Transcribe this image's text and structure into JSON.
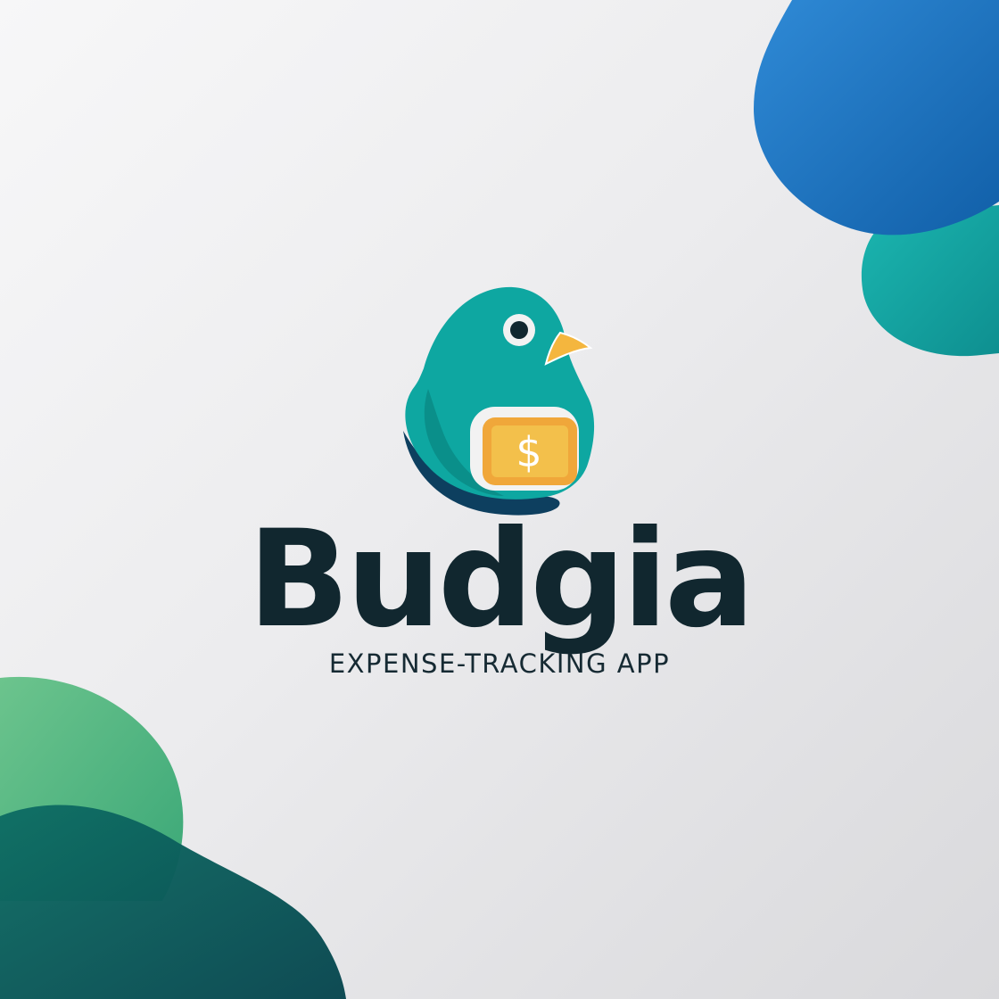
{
  "brand": {
    "name": "Budgia",
    "tagline": "EXPENSE-TRACKING APP"
  },
  "logo": {
    "icon": "budgie-bird-icon",
    "badge_icon": "dollar-icon",
    "badge_symbol": "$"
  },
  "colors": {
    "wordmark": "#11272f",
    "bird_teal": "#0ea7a1",
    "bird_shadow": "#0d3f5f",
    "badge_orange": "#f0a73a",
    "beak": "#f4b63e",
    "blob_blue": "#1f77c0",
    "blob_teal": "#13a6a2",
    "blob_green": "#55bb84",
    "blob_dark_green": "#0b5f5f"
  }
}
